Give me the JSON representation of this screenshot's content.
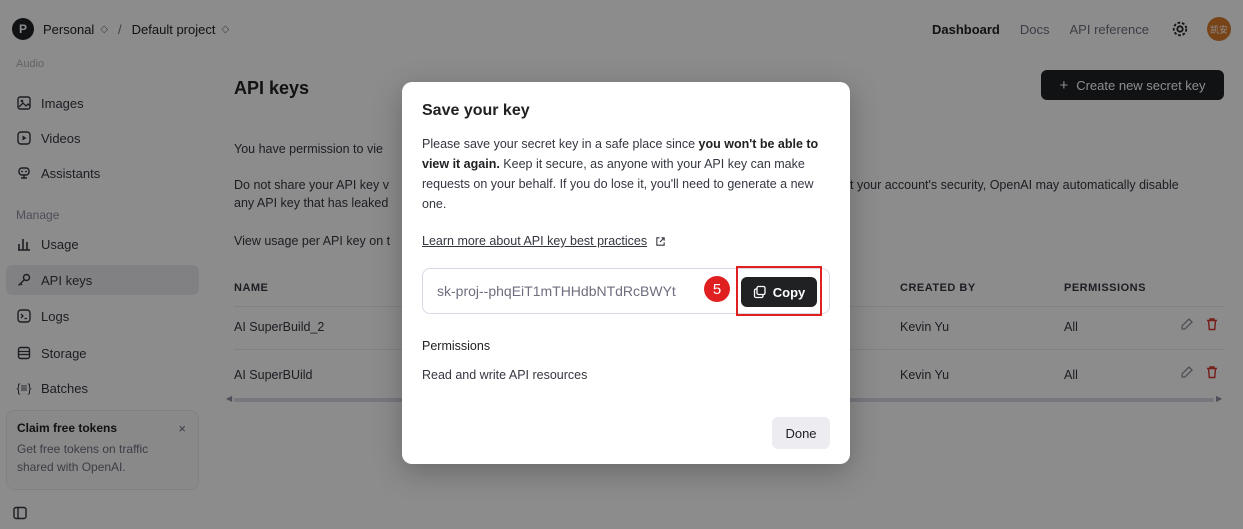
{
  "topbar": {
    "workspace_initial": "P",
    "workspace": "Personal",
    "separator": "/",
    "project": "Default project",
    "nav": [
      "Dashboard",
      "Docs",
      "API reference"
    ],
    "avatar_text": "凯安"
  },
  "sidebar": {
    "faded_item": "Audio",
    "items": [
      {
        "label": "Images",
        "icon": "image-icon"
      },
      {
        "label": "Videos",
        "icon": "video-icon"
      },
      {
        "label": "Assistants",
        "icon": "assistant-icon"
      }
    ],
    "manage_heading": "Manage",
    "manage_items": [
      {
        "label": "Usage",
        "icon": "chart-icon"
      },
      {
        "label": "API keys",
        "icon": "key-icon"
      },
      {
        "label": "Logs",
        "icon": "terminal-icon"
      },
      {
        "label": "Storage",
        "icon": "storage-icon"
      },
      {
        "label": "Batches",
        "icon": "braces-icon"
      }
    ],
    "claim": {
      "title": "Claim free tokens",
      "close": "×",
      "text": "Get free tokens on traffic shared with OpenAI."
    }
  },
  "main": {
    "title": "API keys",
    "create_button": "Create new secret key",
    "para1": "You have permission to vie",
    "para2_left": "Do not share your API key v",
    "para2_left_line2": "any API key that has leaked",
    "para2_right": "t your account's security, OpenAI may automatically disable",
    "para3": "View usage per API key on t",
    "columns": {
      "name": "NAME",
      "created_by": "CREATED BY",
      "permissions": "PERMISSIONS"
    },
    "rows": [
      {
        "name": "AI SuperBuild_2",
        "created_by": "Kevin Yu",
        "permissions": "All"
      },
      {
        "name": "AI SuperBUild",
        "created_by": "Kevin Yu",
        "permissions": "All"
      }
    ]
  },
  "modal": {
    "title": "Save your key",
    "text_part1": "Please save your secret key in a safe place since ",
    "text_bold": "you won't be able to view it again.",
    "text_part2": " Keep it secure, as anyone with your API key can make requests on your behalf. If you do lose it, you'll need to generate a new one.",
    "learn_link": "Learn more about API key best practices",
    "key_value": "sk-proj--phqEiT1mTHHdbNTdRcBWYt",
    "copy_label": "Copy",
    "step_number": "5",
    "permissions_label": "Permissions",
    "permissions_value": "Read and write API resources",
    "done_label": "Done"
  },
  "colors": {
    "accent_dark": "#202123",
    "highlight_red": "#e02020",
    "avatar_orange": "#d97a2b",
    "delete_red": "#d9342b"
  }
}
